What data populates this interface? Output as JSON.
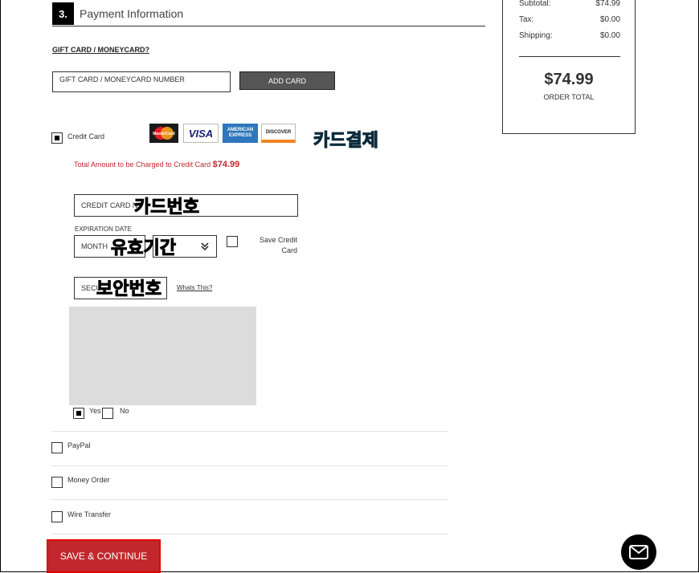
{
  "step": {
    "number": "3.",
    "title": "Payment Information"
  },
  "gift": {
    "link": "GIFT CARD / MONEYCARD?",
    "input_placeholder": "GIFT CARD / MONEYCARD NUMBER",
    "add_button": "ADD CARD"
  },
  "credit": {
    "label": "Credit Card",
    "logos": [
      "MasterCard",
      "VISA",
      "AMERICAN EXPRESS",
      "DISCOVER"
    ],
    "annotation": "카드결제",
    "total_label": "Total Amount to be Charged to Credit Card",
    "total_amount": "$74.99",
    "card_number_placeholder": "CREDIT CARD N",
    "card_number_annotation": "카드번호",
    "expiration_label": "EXPIRATION DATE",
    "month_placeholder": "MONTH",
    "expiration_annotation": "유효기간",
    "save_label": "Save Credit Card",
    "security_placeholder": "SECU",
    "security_annotation": "보안번호",
    "whats_this": "Whats This?",
    "yes": "Yes",
    "no": "No"
  },
  "methods": {
    "paypal": "PayPal",
    "money_order": "Money Order",
    "wire": "Wire Transfer"
  },
  "summary": {
    "subtotal_label": "Subtotal:",
    "subtotal": "$74.99",
    "tax_label": "Tax:",
    "tax": "$0.00",
    "shipping_label": "Shipping:",
    "shipping": "$0.00",
    "total": "$74.99",
    "total_label": "ORDER TOTAL"
  },
  "save_continue": "SAVE & CONTINUE",
  "colors": {
    "accent": "#c1272d",
    "annotation_red": "#c00000",
    "annotation_cyan": "#1ba7d8"
  }
}
